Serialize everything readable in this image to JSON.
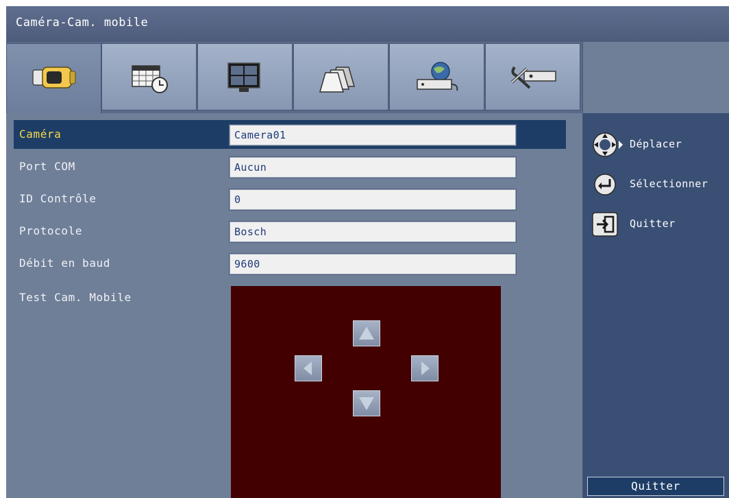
{
  "window": {
    "title": "Caméra-Cam. mobile"
  },
  "tabs": [
    {
      "icon": "camera-icon",
      "active": true
    },
    {
      "icon": "schedule-icon",
      "active": false
    },
    {
      "icon": "monitor-icon",
      "active": false
    },
    {
      "icon": "alarm-icon",
      "active": false
    },
    {
      "icon": "network-icon",
      "active": false
    },
    {
      "icon": "system-tools-icon",
      "active": false
    }
  ],
  "settings": [
    {
      "label": "Caméra",
      "value": "Camera01",
      "selected": true
    },
    {
      "label": "Port COM",
      "value": "Aucun",
      "selected": false
    },
    {
      "label": "ID Contrôle",
      "value": "0",
      "selected": false
    },
    {
      "label": "Protocole",
      "value": "Bosch",
      "selected": false
    },
    {
      "label": "Débit en baud",
      "value": "9600",
      "selected": false
    }
  ],
  "ptz_test": {
    "label": "Test Cam. Mobile",
    "background": "#420000"
  },
  "hints": [
    {
      "icon": "navigate-icon",
      "text": "Déplacer"
    },
    {
      "icon": "enter-icon",
      "text": "Sélectionner"
    },
    {
      "icon": "exit-icon",
      "text": "Quitter"
    }
  ],
  "quit_button": {
    "label": "Quitter"
  },
  "colors": {
    "selected_row": "#1d3d66",
    "selected_label": "#f6d94a",
    "field_text": "#1e3a78"
  }
}
